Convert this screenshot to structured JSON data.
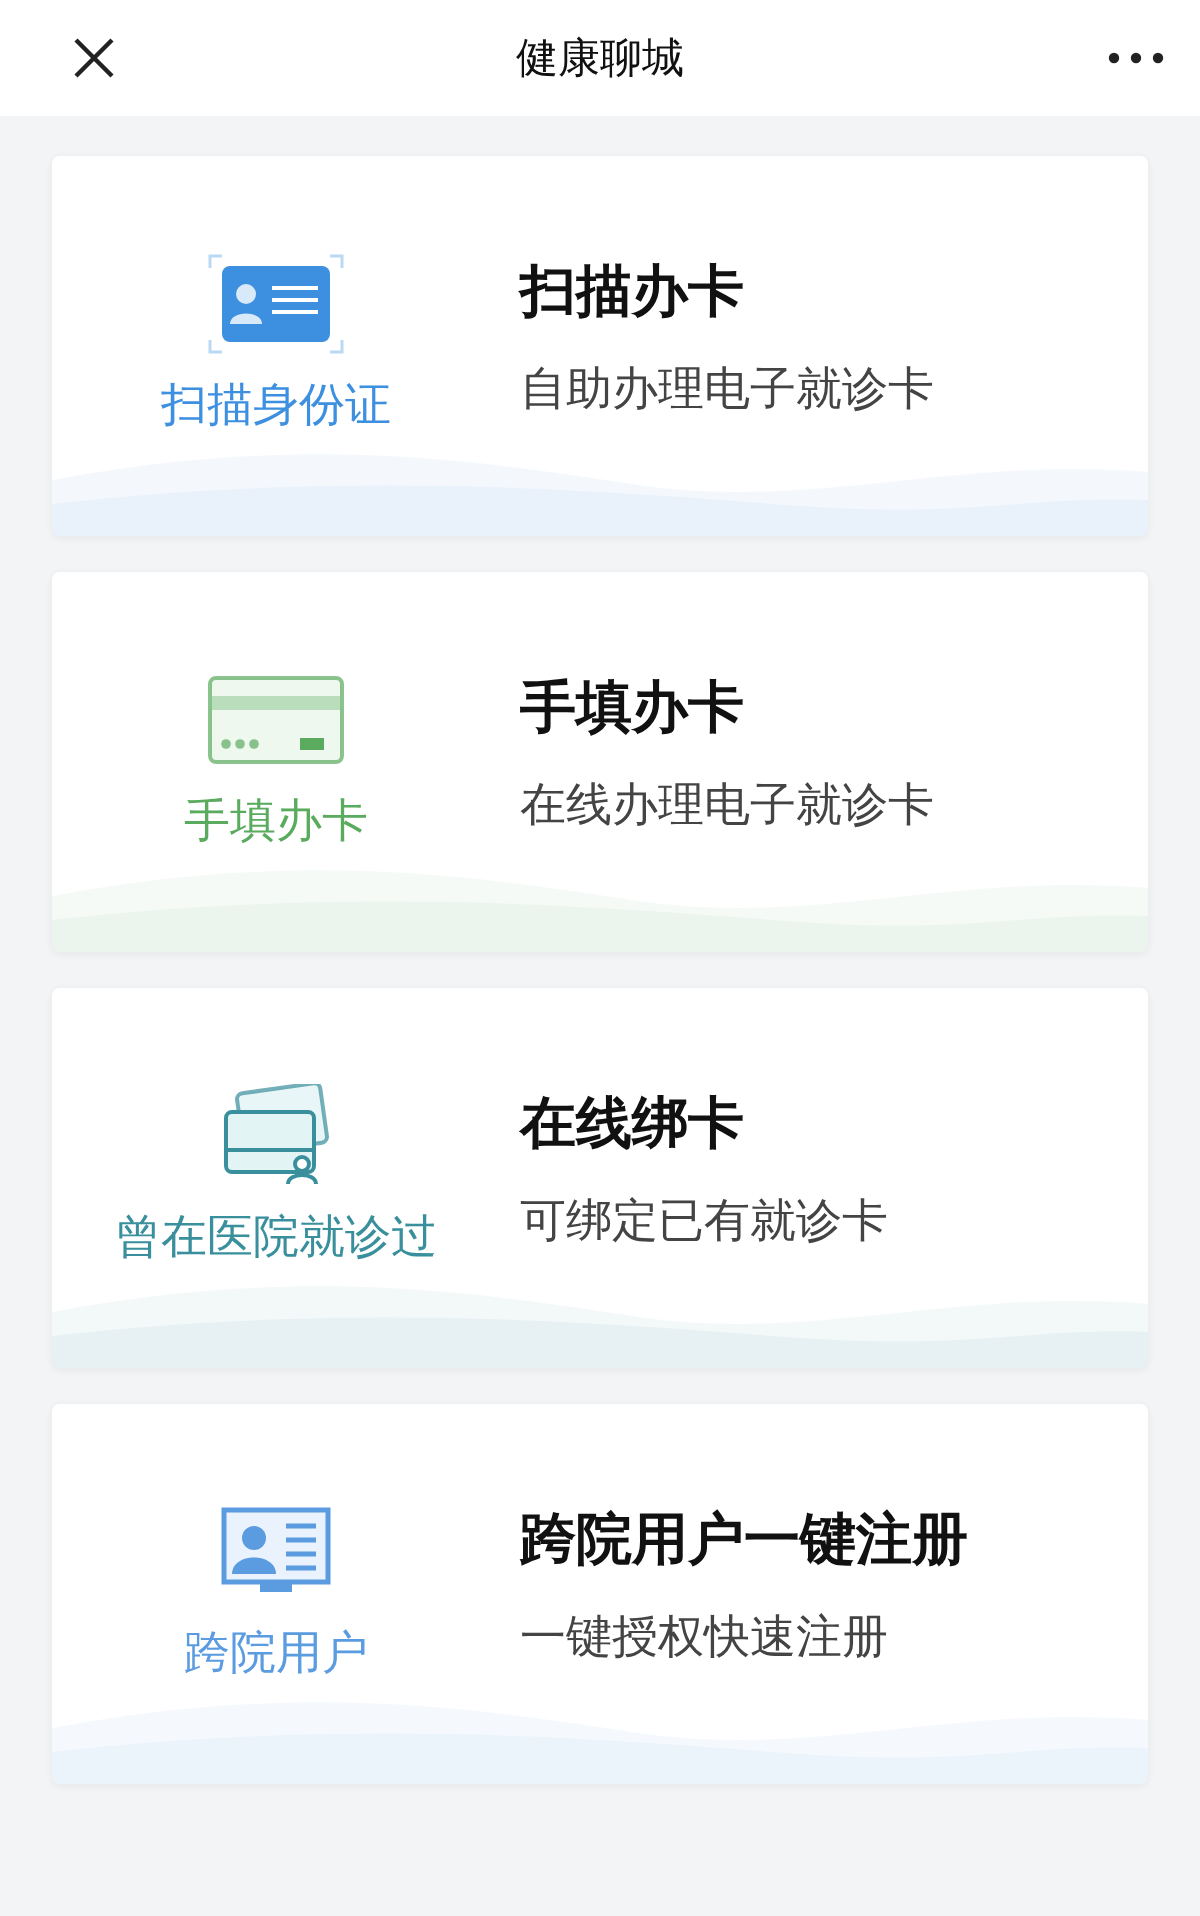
{
  "header": {
    "title": "健康聊城"
  },
  "cards": [
    {
      "kind": "scan",
      "label": "扫描身份证",
      "title": "扫描办卡",
      "subtitle": "自助办理电子就诊卡",
      "color": "#3d8fe0"
    },
    {
      "kind": "manual",
      "label": "手填办卡",
      "title": "手填办卡",
      "subtitle": "在线办理电子就诊卡",
      "color": "#5aab5e"
    },
    {
      "kind": "bind",
      "label": "曾在医院就诊过",
      "title": "在线绑卡",
      "subtitle": "可绑定已有就诊卡",
      "color": "#3a8f9c"
    },
    {
      "kind": "cross",
      "label": "跨院用户",
      "title": "跨院用户一键注册",
      "subtitle": "一键授权快速注册",
      "color": "#5b9be0"
    }
  ]
}
